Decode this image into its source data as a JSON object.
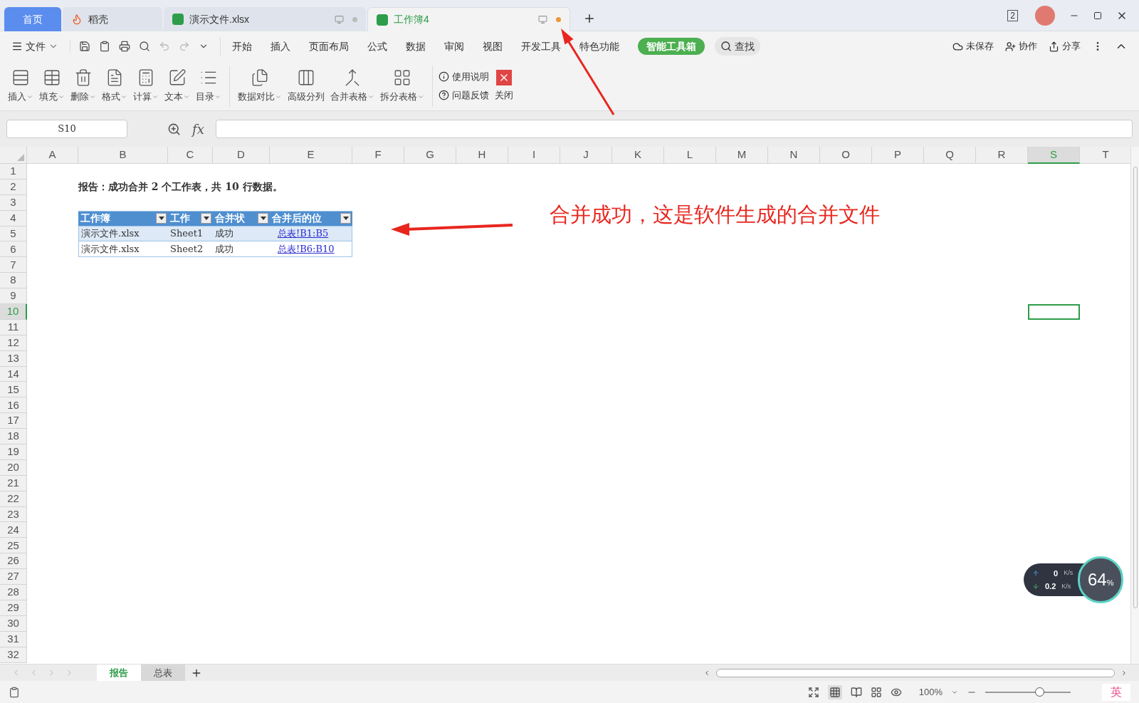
{
  "title_tabs": [
    {
      "label": "首页",
      "kind": "home",
      "selected": false
    },
    {
      "label": "稻壳",
      "kind": "docer",
      "selected": false
    },
    {
      "label": "演示文件.xlsx",
      "kind": "sheet",
      "selected": false,
      "modified": false
    },
    {
      "label": "工作簿4",
      "kind": "sheet",
      "selected": true,
      "modified": true
    }
  ],
  "window_badge": "2",
  "file_menu": "文件",
  "menu_tabs": [
    {
      "label": "开始",
      "selected": false
    },
    {
      "label": "插入",
      "selected": false
    },
    {
      "label": "页面布局",
      "selected": false
    },
    {
      "label": "公式",
      "selected": false
    },
    {
      "label": "数据",
      "selected": false
    },
    {
      "label": "审阅",
      "selected": false
    },
    {
      "label": "视图",
      "selected": false
    },
    {
      "label": "开发工具",
      "selected": false
    },
    {
      "label": "特色功能",
      "selected": false
    },
    {
      "label": "智能工具箱",
      "selected": true
    }
  ],
  "search_button": "查找",
  "right_actions": [
    "未保存",
    "协作",
    "分享"
  ],
  "ribbon": {
    "groups": [
      {
        "items": [
          {
            "label": "插入",
            "dropdown": true
          },
          {
            "label": "填充",
            "dropdown": true
          },
          {
            "label": "删除",
            "dropdown": true
          },
          {
            "label": "格式",
            "dropdown": true
          },
          {
            "label": "计算",
            "dropdown": true
          },
          {
            "label": "文本",
            "dropdown": true
          },
          {
            "label": "目录",
            "dropdown": true
          }
        ]
      },
      {
        "items": [
          {
            "label": "数据对比",
            "dropdown": true
          },
          {
            "label": "高级分列",
            "dropdown": false
          },
          {
            "label": "合并表格",
            "dropdown": true
          },
          {
            "label": "拆分表格",
            "dropdown": true
          }
        ]
      }
    ],
    "help_items": [
      "使用说明",
      "问题反馈"
    ],
    "close_label": "关闭"
  },
  "formula_bar": {
    "name_box": "S10",
    "fx_label": "fx"
  },
  "sheet": {
    "columns": [
      {
        "label": "A",
        "selected": false
      },
      {
        "label": "B",
        "selected": false
      },
      {
        "label": "C",
        "selected": false
      },
      {
        "label": "D",
        "selected": false
      },
      {
        "label": "E",
        "selected": false
      },
      {
        "label": "F",
        "selected": false
      },
      {
        "label": "G",
        "selected": false
      },
      {
        "label": "H",
        "selected": false
      },
      {
        "label": "I",
        "selected": false
      },
      {
        "label": "J",
        "selected": false
      },
      {
        "label": "K",
        "selected": false
      },
      {
        "label": "L",
        "selected": false
      },
      {
        "label": "M",
        "selected": false
      },
      {
        "label": "N",
        "selected": false
      },
      {
        "label": "O",
        "selected": false
      },
      {
        "label": "P",
        "selected": false
      },
      {
        "label": "Q",
        "selected": false
      },
      {
        "label": "R",
        "selected": false
      },
      {
        "label": "S",
        "selected": true
      },
      {
        "label": "T",
        "selected": false
      }
    ],
    "rows": [
      {
        "label": "1",
        "selected": false
      },
      {
        "label": "2",
        "selected": false
      },
      {
        "label": "3",
        "selected": false
      },
      {
        "label": "4",
        "selected": false
      },
      {
        "label": "5",
        "selected": false
      },
      {
        "label": "6",
        "selected": false
      },
      {
        "label": "7",
        "selected": false
      },
      {
        "label": "8",
        "selected": false
      },
      {
        "label": "9",
        "selected": false
      },
      {
        "label": "10",
        "selected": true
      },
      {
        "label": "11",
        "selected": false
      },
      {
        "label": "12",
        "selected": false
      },
      {
        "label": "13",
        "selected": false
      },
      {
        "label": "14",
        "selected": false
      },
      {
        "label": "15",
        "selected": false
      },
      {
        "label": "16",
        "selected": false
      },
      {
        "label": "17",
        "selected": false
      },
      {
        "label": "18",
        "selected": false
      },
      {
        "label": "19",
        "selected": false
      },
      {
        "label": "20",
        "selected": false
      },
      {
        "label": "21",
        "selected": false
      },
      {
        "label": "22",
        "selected": false
      },
      {
        "label": "23",
        "selected": false
      },
      {
        "label": "24",
        "selected": false
      },
      {
        "label": "25",
        "selected": false
      },
      {
        "label": "26",
        "selected": false
      },
      {
        "label": "27",
        "selected": false
      },
      {
        "label": "28",
        "selected": false
      },
      {
        "label": "29",
        "selected": false
      },
      {
        "label": "30",
        "selected": false
      },
      {
        "label": "31",
        "selected": false
      },
      {
        "label": "32",
        "selected": false
      }
    ],
    "report_text": "报告：成功合并 2 个工作表，共 10 行数据。",
    "table": {
      "columns": [
        "工作簿",
        "工作",
        "合并状",
        "合并后的位"
      ],
      "rows": [
        [
          {
            "text": "演示文件.xlsx",
            "kind": "text"
          },
          {
            "text": "Sheet1",
            "kind": "text"
          },
          {
            "text": "成功",
            "kind": "text"
          },
          {
            "text": "总表!B1:B5",
            "kind": "link"
          }
        ],
        [
          {
            "text": "演示文件.xlsx",
            "kind": "text"
          },
          {
            "text": "Sheet2",
            "kind": "text"
          },
          {
            "text": "成功",
            "kind": "text"
          },
          {
            "text": "总表!B6:B10",
            "kind": "link"
          }
        ]
      ]
    }
  },
  "annotation": {
    "text": "合并成功，这是软件生成的合并文件"
  },
  "network_widget": {
    "upload": "0",
    "upload_unit": "K/s",
    "download": "0.2",
    "download_unit": "K/s",
    "percent": "64",
    "percent_unit": "%"
  },
  "sheet_tabs": [
    {
      "label": "报告",
      "selected": true
    },
    {
      "label": "总表",
      "selected": false
    }
  ],
  "status_bar": {
    "zoom": "100%",
    "zoom_slider": {
      "level": 0.63
    },
    "ime": "英"
  }
}
